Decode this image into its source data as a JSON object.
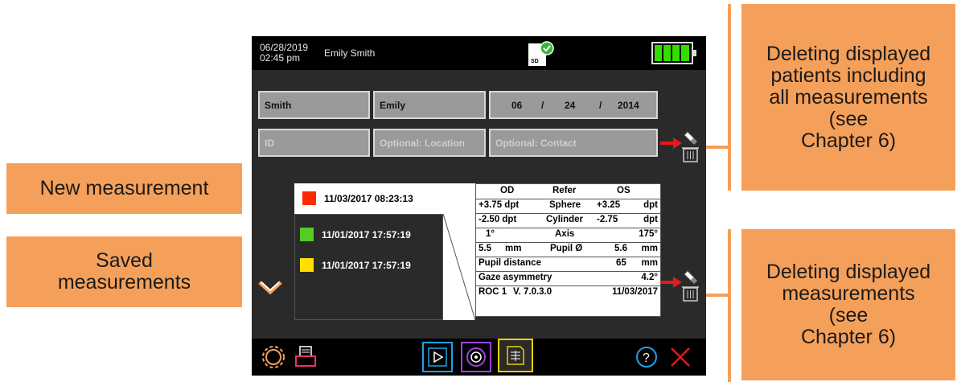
{
  "status": {
    "date": "06/28/2019",
    "time": "02:45 pm",
    "patient": "Emily Smith",
    "sd_label": "SD"
  },
  "patient_form": {
    "last_name": "Smith",
    "first_name": "Emily",
    "dob_month": "06",
    "dob_day": "24",
    "dob_year": "2014",
    "dob_sep": "/",
    "id_placeholder": "ID",
    "location_placeholder": "Optional: Location",
    "contact_placeholder": "Optional: Contact"
  },
  "measurements": {
    "new": {
      "datetime": "11/03/2017 08:23:13",
      "color": "#ff2a00"
    },
    "saved": [
      {
        "datetime": "11/01/2017 17:57:19",
        "color": "#55cc22"
      },
      {
        "datetime": "11/01/2017 17:57:19",
        "color": "#ffe000"
      }
    ]
  },
  "results": {
    "header": {
      "od": "OD",
      "refer": "Refer",
      "os": "OS"
    },
    "sphere": {
      "od": "+3.75 dpt",
      "label": "Sphere",
      "os_val": "+3.25",
      "os_unit": "dpt"
    },
    "cylinder": {
      "od": "-2.50 dpt",
      "label": "Cylinder",
      "os_val": "-2.75",
      "os_unit": "dpt"
    },
    "axis": {
      "od": "1°",
      "label": "Axis",
      "os": "175°"
    },
    "pupil": {
      "od_val": "5.5",
      "od_unit": "mm",
      "label": "Pupil Ø",
      "os_val": "5.6",
      "os_unit": "mm"
    },
    "pupil_distance": {
      "label": "Pupil distance",
      "val": "65",
      "unit": "mm"
    },
    "gaze": {
      "label": "Gaze asymmetry",
      "val": "4.2°"
    },
    "footer": {
      "roc": "ROC 1",
      "version": "V. 7.0.3.0",
      "date": "11/03/2017"
    }
  },
  "callouts": {
    "new_measurement": "New measurement",
    "saved_line1": "Saved",
    "saved_line2": "measurements",
    "delete_patients": [
      "Deleting displayed",
      "patients including",
      "all measurements",
      "(see",
      "Chapter 6)"
    ],
    "delete_measurements": [
      "Deleting displayed",
      "measurements",
      "(see",
      "Chapter 6)"
    ]
  },
  "colors": {
    "callout": "#f5a05a",
    "screen_bg": "#2a2a2a",
    "battery": "#33dd00",
    "arrow": "#e8191a"
  },
  "icons": [
    "sd-card-icon",
    "check-icon",
    "battery-icon",
    "eraser-icon",
    "trash-icon",
    "arrow-right-icon",
    "chevron-down-icon",
    "settings-gear-icon",
    "printer-icon",
    "play-video-icon",
    "target-icon",
    "results-icon",
    "help-icon",
    "close-icon"
  ]
}
